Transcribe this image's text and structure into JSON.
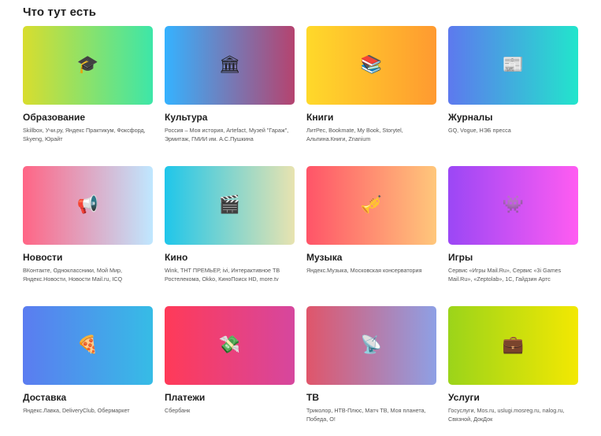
{
  "section": {
    "title": "Что тут есть"
  },
  "cards": [
    {
      "title": "Образование",
      "icon": "🎓",
      "icon_name": "graduation-cap-icon",
      "desc": "Skillbox, Учи.ру, Яндекс Практикум, Фоксфорд, Skyeng, Юрайт",
      "gradient": [
        "#d8dd2e",
        "#3de6a8"
      ]
    },
    {
      "title": "Культура",
      "icon": "🏛",
      "icon_name": "museum-icon",
      "desc": "Россия – Моя история, Artefact, Музей \"Гараж\", Эрмитаж, ГМИИ им. А.С.Пушкина",
      "gradient": [
        "#35b2ff",
        "#b5436f"
      ]
    },
    {
      "title": "Книги",
      "icon": "📚",
      "icon_name": "books-icon",
      "desc": "ЛитРес, Bookmate, My Book, Storytel, Альпина.Книги, Znanium",
      "gradient": [
        "#ffd92a",
        "#ff9a30"
      ]
    },
    {
      "title": "Журналы",
      "icon": "📰",
      "icon_name": "newspaper-icon",
      "desc": "GQ, Vogue, НЭБ пресса",
      "gradient": [
        "#5d79ee",
        "#22e5cc"
      ]
    },
    {
      "title": "Новости",
      "icon": "📢",
      "icon_name": "megaphone-icon",
      "desc": "ВКонтакте, Одноклассники, Мой Мир, Яндекс.Новости, Новости Mail.ru, ICQ",
      "gradient": [
        "#ff6585",
        "#bfe7ff"
      ]
    },
    {
      "title": "Кино",
      "icon": "🎬",
      "icon_name": "clapperboard-icon",
      "desc": "Wink, ТНТ ПРЕМЬЕР, ivi, Интерактивное ТВ Ростелекома, Okko, КиноПоиск HD, more.tv",
      "gradient": [
        "#1fc6ea",
        "#e8e3b0"
      ]
    },
    {
      "title": "Музыка",
      "icon": "🎺",
      "icon_name": "trumpet-icon",
      "desc": "Яндекс.Музыка, Московская консерватория",
      "gradient": [
        "#ff5468",
        "#ffc77b"
      ]
    },
    {
      "title": "Игры",
      "icon": "👾",
      "icon_name": "space-invader-icon",
      "desc": "Сервис «Игры Mail.Ru», Сервис «3i Games Mail.Ru», «Zeptolab», 1С, Гайдзин Артс",
      "gradient": [
        "#9b47f5",
        "#ff5cf2"
      ]
    },
    {
      "title": "Доставка",
      "icon": "🍕",
      "icon_name": "pizza-icon",
      "desc": "Яндекс.Лавка, DeliveryClub, Обермаркет",
      "gradient": [
        "#5b7cf0",
        "#36bce6"
      ]
    },
    {
      "title": "Платежи",
      "icon": "💸",
      "icon_name": "money-wings-icon",
      "desc": "Сбербанк",
      "gradient": [
        "#ff3a58",
        "#d6479e"
      ]
    },
    {
      "title": "ТВ",
      "icon": "📡",
      "icon_name": "satellite-dish-icon",
      "desc": "Триколор, НТВ-Плюс, Матч ТВ, Моя планета, Победа, О!",
      "gradient": [
        "#e0556a",
        "#8ea0e5"
      ]
    },
    {
      "title": "Услуги",
      "icon": "💼",
      "icon_name": "briefcase-icon",
      "desc": "Госуслуги, Mos.ru, uslugi.mosreg.ru, nalog.ru, Связной, ДокДок",
      "gradient": [
        "#9bd41a",
        "#f3e802"
      ]
    }
  ]
}
